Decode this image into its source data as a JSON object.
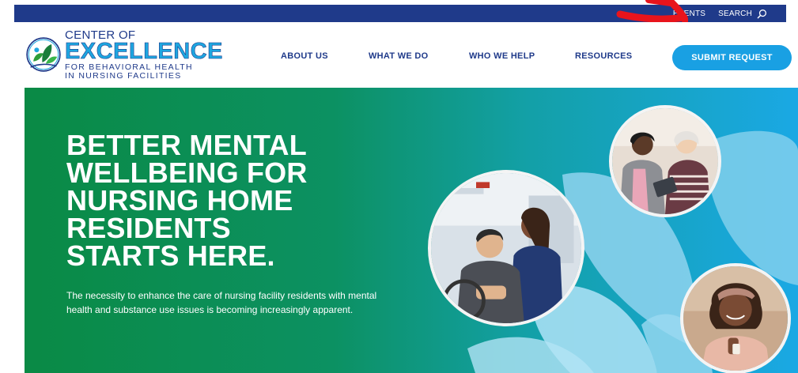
{
  "utility_bar": {
    "links": [
      "EVENTS",
      "SEARCH"
    ],
    "search_icon": "search-icon",
    "background": "#1f3a8a"
  },
  "logo": {
    "line1": "CENTER OF",
    "line2": "EXCELLENCE",
    "line3": "FOR BEHAVIORAL HEALTH",
    "line4": "IN NURSING FACILITIES",
    "icon": "leaves-circle-logo-icon"
  },
  "nav": {
    "items": [
      "ABOUT US",
      "WHAT WE DO",
      "WHO WE HELP",
      "RESOURCES"
    ],
    "cta": "SUBMIT REQUEST"
  },
  "hero": {
    "title_lines": [
      "BETTER MENTAL",
      "WELLBEING FOR",
      "NURSING HOME",
      "RESIDENTS",
      "STARTS HERE."
    ],
    "description": "The necessity to enhance the care of nursing facility residents with mental health and substance use issues is becoming increasingly apparent."
  },
  "colors": {
    "brand_navy": "#1f3a8a",
    "brand_blue": "#19a0e3",
    "hero_green": "#0a8a45",
    "hero_blue": "#1aa8e4",
    "annotation_red": "#e8141c"
  }
}
